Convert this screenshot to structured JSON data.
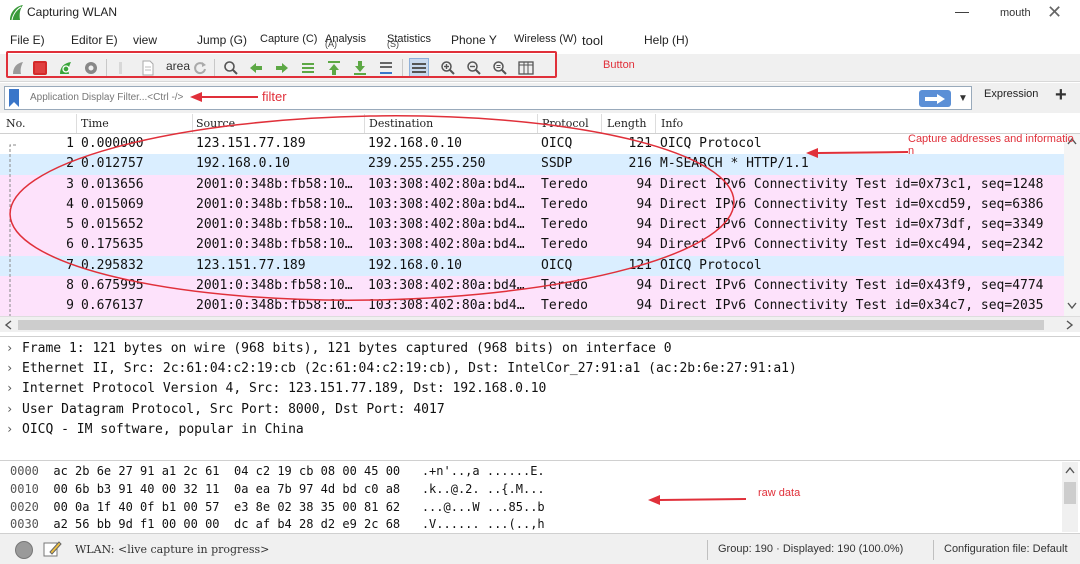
{
  "window": {
    "title": "Capturing WLAN",
    "user": "mouth",
    "minimize_glyph": "—",
    "close_glyph": "✕"
  },
  "menu": [
    {
      "label": "File E)"
    },
    {
      "label": "Editor E)"
    },
    {
      "label": "view"
    },
    {
      "label": "Jump (G)"
    },
    {
      "label": "Capture (C)"
    },
    {
      "label": "Analysis",
      "sub": "(A)"
    },
    {
      "label": "Statistics",
      "sub": "(S)"
    },
    {
      "label": "Phone Y"
    },
    {
      "label": "Wireless (W)"
    },
    {
      "label": "tool"
    },
    {
      "label": "Help (H)"
    }
  ],
  "toolbar": {
    "area_label": "area",
    "annotation": "Button",
    "icons": [
      "start-capture",
      "stop-capture",
      "restart-capture",
      "capture-options",
      "open-file",
      "save-file",
      "close-file",
      "reload",
      "find-packet",
      "go-back",
      "go-forward",
      "go-to-packet",
      "go-first",
      "go-last",
      "auto-scroll",
      "colorize",
      "zoom-in",
      "zoom-out",
      "zoom-normal",
      "resize-columns"
    ]
  },
  "filter": {
    "placeholder": "Application Display Filter...<Ctrl -/>",
    "annotation": "filter",
    "expression_label": "Expression",
    "add_glyph": "+",
    "dropdown_glyph": "▼"
  },
  "packet_list": {
    "columns": [
      "No.",
      "Time",
      "Source",
      "Destination",
      "Protocol",
      "Length",
      "Info"
    ],
    "annotation": "Capture addresses and informatio n",
    "rows": [
      {
        "no": "1",
        "time": "0.000000",
        "src": "123.151.77.189",
        "dst": "192.168.0.10",
        "proto": "OICQ",
        "len": "121",
        "info": "OICQ Protocol",
        "color": "white"
      },
      {
        "no": "2",
        "time": "0.012757",
        "src": "192.168.0.10",
        "dst": "239.255.255.250",
        "proto": "SSDP",
        "len": "216",
        "info": "M-SEARCH * HTTP/1.1",
        "color": "udp"
      },
      {
        "no": "3",
        "time": "0.013656",
        "src": "2001:0:348b:fb58:10…",
        "dst": "103:308:402:80a:bd4…",
        "proto": "Teredo",
        "len": "94",
        "info": "Direct IPv6 Connectivity Test id=0x73c1, seq=1248",
        "color": "teredo"
      },
      {
        "no": "4",
        "time": "0.015069",
        "src": "2001:0:348b:fb58:10…",
        "dst": "103:308:402:80a:bd4…",
        "proto": "Teredo",
        "len": "94",
        "info": "Direct IPv6 Connectivity Test id=0xcd59, seq=6386",
        "color": "teredo"
      },
      {
        "no": "5",
        "time": "0.015652",
        "src": "2001:0:348b:fb58:10…",
        "dst": "103:308:402:80a:bd4…",
        "proto": "Teredo",
        "len": "94",
        "info": "Direct IPv6 Connectivity Test id=0x73df, seq=3349",
        "color": "teredo"
      },
      {
        "no": "6",
        "time": "0.175635",
        "src": "2001:0:348b:fb58:10…",
        "dst": "103:308:402:80a:bd4…",
        "proto": "Teredo",
        "len": "94",
        "info": "Direct IPv6 Connectivity Test id=0xc494, seq=2342",
        "color": "teredo"
      },
      {
        "no": "7",
        "time": "0.295832",
        "src": "123.151.77.189",
        "dst": "192.168.0.10",
        "proto": "OICQ",
        "len": "121",
        "info": "OICQ Protocol",
        "color": "udp"
      },
      {
        "no": "8",
        "time": "0.675995",
        "src": "2001:0:348b:fb58:10…",
        "dst": "103:308:402:80a:bd4…",
        "proto": "Teredo",
        "len": "94",
        "info": "Direct IPv6 Connectivity Test id=0x43f9, seq=4774",
        "color": "teredo"
      },
      {
        "no": "9",
        "time": "0.676137",
        "src": "2001:0:348b:fb58:10…",
        "dst": "103:308:402:80a:bd4…",
        "proto": "Teredo",
        "len": "94",
        "info": "Direct IPv6 Connectivity Test id=0x34c7, seq=2035",
        "color": "teredo"
      }
    ]
  },
  "details": [
    "Frame 1: 121 bytes on wire (968 bits), 121 bytes captured (968 bits) on interface 0",
    "Ethernet II, Src: 2c:61:04:c2:19:cb (2c:61:04:c2:19:cb), Dst: IntelCor_27:91:a1 (ac:2b:6e:27:91:a1)",
    "Internet Protocol Version 4, Src: 123.151.77.189, Dst: 192.168.0.10",
    "User Datagram Protocol, Src Port: 8000, Dst Port: 4017",
    "OICQ - IM software, popular in China"
  ],
  "hex": {
    "annotation": "raw data",
    "rows": [
      {
        "offset": "0000",
        "bytes": "ac 2b 6e 27 91 a1 2c 61  04 c2 19 cb 08 00 45 00",
        "ascii": ".+n'..,a ......E."
      },
      {
        "offset": "0010",
        "bytes": "00 6b b3 91 40 00 32 11  0a ea 7b 97 4d bd c0 a8",
        "ascii": ".k..@.2. ..{.M..."
      },
      {
        "offset": "0020",
        "bytes": "00 0a 1f 40 0f b1 00 57  e3 8e 02 38 35 00 81 62",
        "ascii": "...@...W ...85..b"
      },
      {
        "offset": "0030",
        "bytes": "a2 56 bb 9d f1 00 00 00  dc af b4 28 d2 e9 2c 68",
        "ascii": ".V...... ...(..,h"
      }
    ]
  },
  "status": {
    "interface": "WLAN: <live capture in progress>",
    "counts": "Group: 190 · Displayed: 190 (100.0%)",
    "profile": "Configuration file: Default"
  },
  "colors": {
    "annotation_red": "#e0303a",
    "row_teredo": "#fde2fb",
    "row_udp": "#daeeff",
    "apply_blue": "#5b8fd6"
  }
}
